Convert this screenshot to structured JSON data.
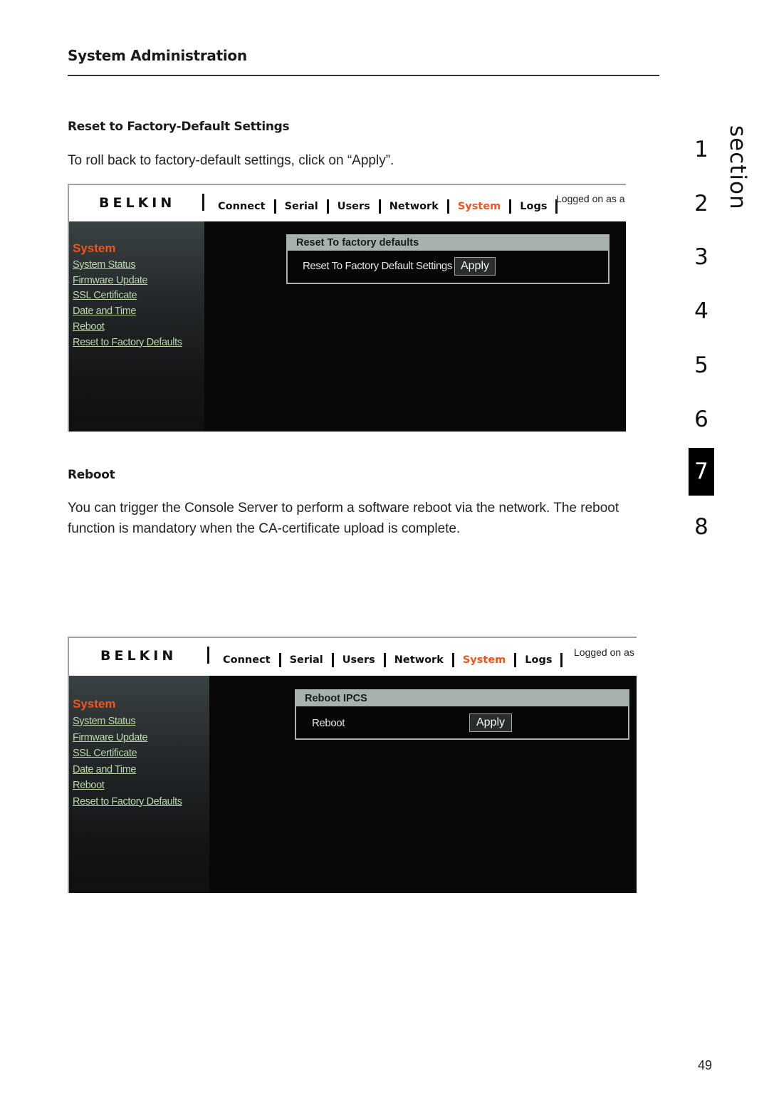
{
  "page": {
    "title": "System Administration",
    "page_number": "49"
  },
  "section_nav": {
    "label": "section",
    "numbers": [
      "1",
      "2",
      "3",
      "4",
      "5",
      "6",
      "7",
      "8"
    ],
    "active": "7"
  },
  "section_reset": {
    "heading": "Reset to Factory-Default Settings",
    "body": "To roll back to factory-default settings, click on “Apply”."
  },
  "section_reboot": {
    "heading": "Reboot",
    "body": "You can trigger the Console Server to perform a software reboot via the network. The reboot function is mandatory when the CA-certificate upload is complete."
  },
  "screenshot1": {
    "logo": "BELKIN",
    "nav": [
      {
        "label": "Connect",
        "active": false
      },
      {
        "label": "Serial",
        "active": false
      },
      {
        "label": "Users",
        "active": false
      },
      {
        "label": "Network",
        "active": false
      },
      {
        "label": "System",
        "active": true
      },
      {
        "label": "Logs",
        "active": false
      }
    ],
    "logged_on": "Logged on as a",
    "sidebar": {
      "title": "System",
      "links": [
        "System Status",
        "Firmware Update",
        "SSL Certificate",
        "Date and Time",
        "Reboot",
        "Reset to Factory Defaults"
      ]
    },
    "panel": {
      "title": "Reset To factory defaults",
      "label": "Reset To Factory Default Settings",
      "button": "Apply"
    }
  },
  "screenshot2": {
    "logo": "BELKIN",
    "nav": [
      {
        "label": "Connect",
        "active": false
      },
      {
        "label": "Serial",
        "active": false
      },
      {
        "label": "Users",
        "active": false
      },
      {
        "label": "Network",
        "active": false
      },
      {
        "label": "System",
        "active": true
      },
      {
        "label": "Logs",
        "active": false
      }
    ],
    "logged_on": "Logged on as",
    "sidebar": {
      "title": "System",
      "links": [
        "System Status",
        "Firmware Update",
        "SSL Certificate",
        "Date and Time",
        "Reboot",
        "Reset to Factory Defaults"
      ]
    },
    "panel": {
      "title": "Reboot IPCS",
      "label": "Reboot",
      "button": "Apply"
    }
  },
  "colors": {
    "accent_orange": "#f2541c",
    "sidebar_link": "#b9d7a8",
    "panel_header": "#a7b1b0"
  }
}
